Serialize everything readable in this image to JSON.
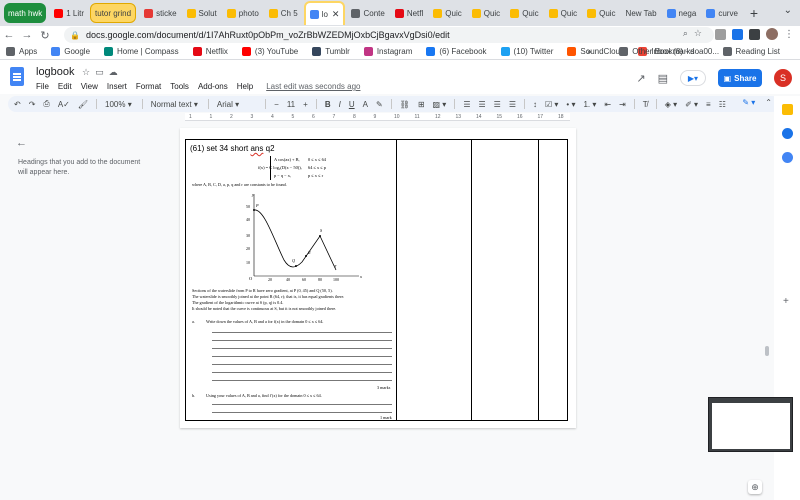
{
  "browser": {
    "tabs": [
      {
        "label": "math hwk",
        "type": "group-green"
      },
      {
        "label": "1 Litr",
        "fav": "#ff0000"
      },
      {
        "label": "tutor grind",
        "type": "group-yellow"
      },
      {
        "label": "sticke",
        "fav": "#e53935"
      },
      {
        "label": "Solut",
        "fav": "#fbbc04"
      },
      {
        "label": "photo",
        "fav": "#fbbc04"
      },
      {
        "label": "Ch 5",
        "fav": "#fbbc04"
      },
      {
        "label": "lo",
        "fav": "#4285f4",
        "active": true
      },
      {
        "label": "Conte",
        "fav": "#5f6368"
      },
      {
        "label": "Netfl",
        "fav": "#e50914"
      },
      {
        "label": "Quic",
        "fav": "#fbbc04"
      },
      {
        "label": "Quic",
        "fav": "#fbbc04"
      },
      {
        "label": "Quic",
        "fav": "#fbbc04"
      },
      {
        "label": "Quic",
        "fav": "#fbbc04"
      },
      {
        "label": "Quic",
        "fav": "#fbbc04"
      },
      {
        "label": "New Tab"
      },
      {
        "label": "nega",
        "fav": "#4285f4"
      },
      {
        "label": "curve",
        "fav": "#4285f4"
      }
    ],
    "new_tab_icon": "+",
    "tab_close": "✕",
    "url": "docs.google.com/document/d/1I7AhRuxt0pObPm_voZrBbWZEDMjOxbCjBgavxVgDsi0/edit",
    "bookmarks": [
      {
        "label": "Apps",
        "fav": "#5f6368"
      },
      {
        "label": "Google",
        "fav": "#4285f4"
      },
      {
        "label": "Home | Compass",
        "fav": "#00897b"
      },
      {
        "label": "Netflix",
        "fav": "#e50914"
      },
      {
        "label": "(3) YouTube",
        "fav": "#ff0000"
      },
      {
        "label": "Tumblr",
        "fav": "#35465c"
      },
      {
        "label": "Instagram",
        "fav": "#c13584"
      },
      {
        "label": "(6) Facebook",
        "fav": "#1877f2"
      },
      {
        "label": "(10) Twitter",
        "fav": "#1da1f2"
      },
      {
        "label": "SoundCloud",
        "fav": "#ff5500"
      },
      {
        "label": "Inbox (8) - doa00...",
        "fav": "#ea4335"
      }
    ],
    "bookmarks_more": "»",
    "bookmarks_right": [
      "Other Bookmarks",
      "Reading List"
    ]
  },
  "docs": {
    "title": "logbook",
    "menu": [
      "File",
      "Edit",
      "View",
      "Insert",
      "Format",
      "Tools",
      "Add-ons",
      "Help"
    ],
    "last_edit": "Last edit was seconds ago",
    "share_label": "Share",
    "user_initial": "S",
    "toolbar": {
      "zoom": "100%",
      "style": "Normal text",
      "font": "Arial",
      "size": "11",
      "bold": "B",
      "italic": "I",
      "underline": "U",
      "text_color": "A"
    },
    "ruler": [
      "1",
      "1",
      "2",
      "3",
      "4",
      "5",
      "6",
      "7",
      "8",
      "9",
      "10",
      "11",
      "12",
      "13",
      "14",
      "15",
      "16",
      "17",
      "18"
    ],
    "outline_hint": "Headings that you add to the document will appear here."
  },
  "document": {
    "cell_title_pre": "(61) set 34 short ",
    "cell_title_ul": "ans",
    "cell_title_post": " q2",
    "function_rows": [
      {
        "expr": "A cos(ax) + B,",
        "domain": "0 ≤ x ≤ 64"
      },
      {
        "expr": "f(x) = C log₂(D(x − 50)),",
        "domain": "64 ≤ x ≤ p"
      },
      {
        "expr": "p − q − x,",
        "domain": "p ≤ x ≤ r"
      }
    ],
    "where_text": "where A, B, C, D, a, p, q and r are constants to be found.",
    "graph": {
      "y_axis_letter": "y",
      "x_axis_letter": "x",
      "y_ticks": [
        "50",
        "40",
        "30",
        "20",
        "10"
      ],
      "x_ticks": [
        "20",
        "40",
        "60",
        "80",
        "100"
      ],
      "origin": "O",
      "points": [
        "P",
        "Q",
        "R",
        "S",
        "T"
      ]
    },
    "description": [
      "Sections of the waterslide from P to R have zero gradient, at P (0, 45) and Q (50, 5).",
      "The waterslide is smoothly joined at the point R (64, r); that is, it has equal gradients there.",
      "The gradient of the logarithmic curve at S (p, q) is 0.4.",
      "It should be noted that the curve is continuous at S, but it is not smoothly joined there."
    ],
    "part_a_label": "a.",
    "part_a": "Write down the values of A, B and a for f(x) in the domain 0 ≤ x ≤ 64.",
    "part_a_marks": "3 marks",
    "part_b_label": "b.",
    "part_b": "Using your values of A, B and a, find f′(x) for the domain 0 ≤ x ≤ 64.",
    "part_b_marks": "1 mark"
  },
  "colors": {
    "docs_blue": "#4285f4",
    "share_blue": "#1a73e8",
    "avatar_red": "#d93025",
    "group_green": "#1e8e3e",
    "group_yellow": "#fdd663"
  }
}
